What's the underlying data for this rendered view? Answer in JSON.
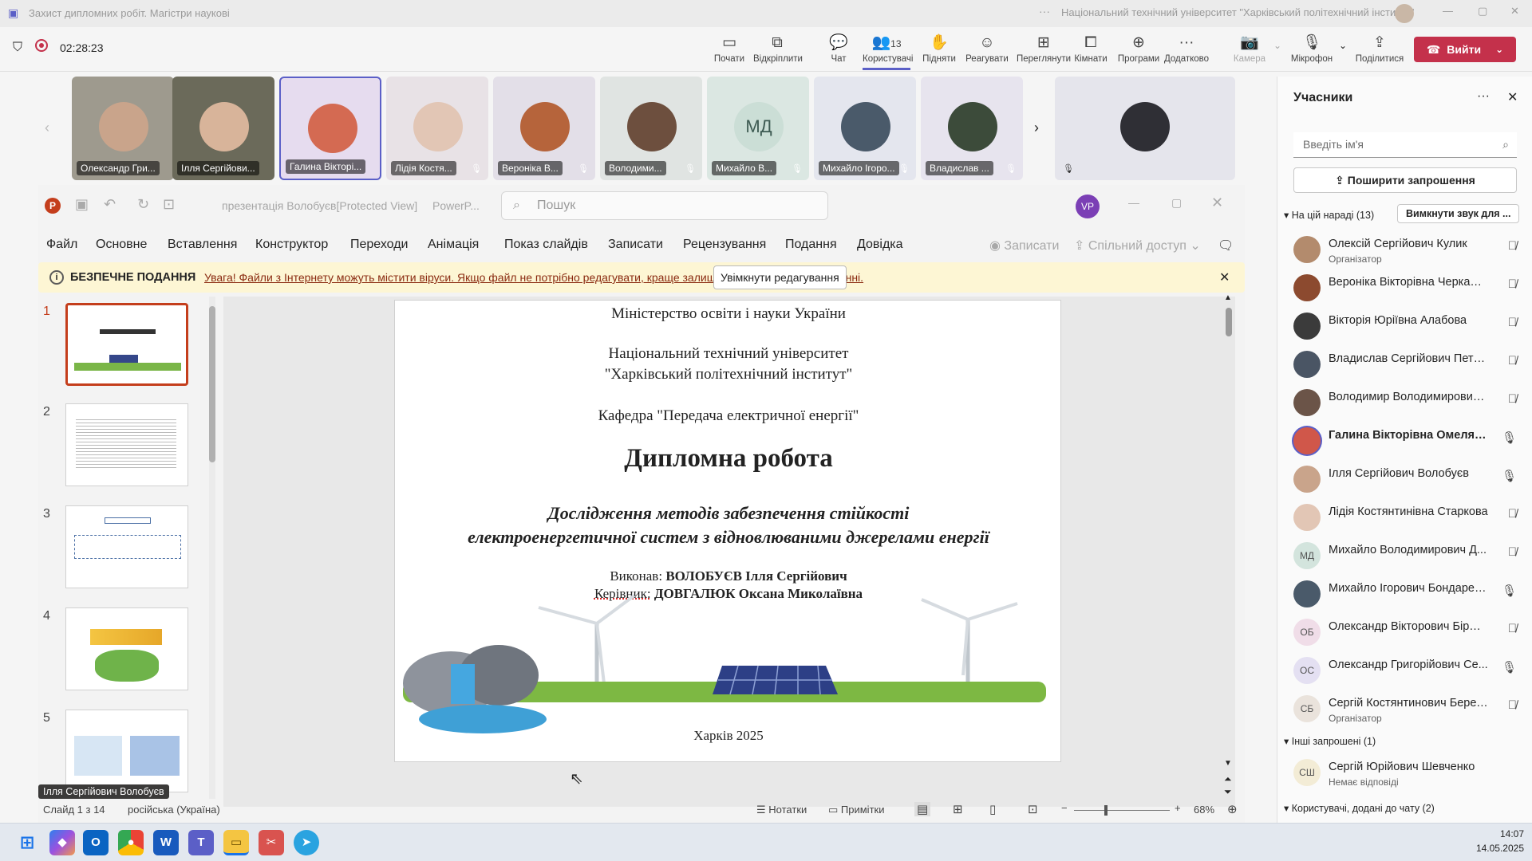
{
  "titlebar": {
    "title": "Захист дипломних робіт. Магістри наукові",
    "org": "Національний технічний університет \"Харківський політехнічний інститут\""
  },
  "call": {
    "timer": "02:28:23",
    "people_count": "13"
  },
  "toolbar": {
    "start": "Почати",
    "open": "Відкріплити",
    "chat": "Чат",
    "people": "Користувачі",
    "raise": "Підняти",
    "react": "Реагувати",
    "view": "Переглянути",
    "rooms": "Кімнати",
    "apps": "Програми",
    "more": "Додатково",
    "camera": "Камера",
    "mic": "Мікрофон",
    "share": "Поділитися",
    "leave": "Вийти"
  },
  "participants_strip": [
    {
      "name": "Олександр Гри..."
    },
    {
      "name": "Ілля Сергійови..."
    },
    {
      "name": "Галина Вікторі..."
    },
    {
      "name": "Лідія Костя..."
    },
    {
      "name": "Вероніка В..."
    },
    {
      "name": "Володими..."
    },
    {
      "name": "Михайло В...",
      "initials": "МД"
    },
    {
      "name": "Михайло Ігоро..."
    },
    {
      "name": "Владислав ..."
    }
  ],
  "ppt": {
    "doc_title": "презентація Волобуєв[Protected View]",
    "app": "PowerP...",
    "search": "Пошук",
    "user": "VP",
    "tabs": [
      "Файл",
      "Основне",
      "Вставлення",
      "Конструктор",
      "Переходи",
      "Анімація",
      "Показ слайдів",
      "Записати",
      "Рецензування",
      "Подання",
      "Довідка"
    ],
    "record": "Записати",
    "coauthor": "Спільний доступ",
    "banner": {
      "label": "БЕЗПЕЧНЕ ПОДАННЯ",
      "text": "Увага! Файли з Інтернету можуть містити віруси. Якщо файл не потрібно редагувати, краще залишатися в безпечному поданні.",
      "button": "Увімкнути редагування"
    },
    "slide_numbers": [
      "1",
      "2",
      "3",
      "4",
      "5"
    ],
    "status": {
      "slide": "Слайд 1 з 14",
      "lang": "російська (Україна)",
      "notes": "Нотатки",
      "comments": "Примітки",
      "zoom": "68%",
      "tooltip": "Ілля Сергійович Волобуєв"
    }
  },
  "slide": {
    "l1": "Міністерство освіти і науки України",
    "l2": "Національний технічний університет",
    "l3": "\"Харківський політехнічний інститут\"",
    "l4": "Кафедра \"Передача електричної енергії\"",
    "title": "Дипломна робота",
    "sub1": "Дослідження методів забезпечення стійкості",
    "sub2": "електроенергетичної систем з відновлюваними джерелами енергії",
    "exec_label": "Виконав:",
    "exec_name": "ВОЛОБУЄВ  Ілля Сергійович",
    "sup_label": "Керівник:",
    "sup_name": "ДОВГАЛЮК Оксана Миколаївна",
    "city": "Харків 2025"
  },
  "panel": {
    "title": "Учасники",
    "search": "Введіть ім'я",
    "invite": "Поширити запрошення",
    "section": "На цій нараді (13)",
    "mute_all": "Вимкнути звук для ...",
    "people": [
      {
        "name": "Олексій Сергійович Кулик",
        "sub": "Організатор",
        "mic": "off"
      },
      {
        "name": "Вероніка Вікторівна Черкаш...",
        "sub": "",
        "mic": "off"
      },
      {
        "name": "Вікторія Юріївна Алабова",
        "sub": "",
        "mic": "off"
      },
      {
        "name": "Владислав Сергійович Петре...",
        "sub": "",
        "mic": "off"
      },
      {
        "name": "Володимир Володимирович ...",
        "sub": "",
        "mic": "off"
      },
      {
        "name": "Галина Вікторівна Омеляне...",
        "sub": "",
        "mic": "on"
      },
      {
        "name": "Ілля Сергійович Волобуєв",
        "sub": "",
        "mic": "on"
      },
      {
        "name": "Лідія Костянтинівна Старкова",
        "sub": "",
        "mic": "off"
      },
      {
        "name": "Михайло Володимирович Д...",
        "sub": "",
        "mic": "off",
        "initials": "МД"
      },
      {
        "name": "Михайло Ігорович Бондарен...",
        "sub": "",
        "mic": "on"
      },
      {
        "name": "Олександр Вікторович Бірюк...",
        "sub": "",
        "mic": "off",
        "initials": "ОБ"
      },
      {
        "name": "Олександр Григорійович Се...",
        "sub": "",
        "mic": "on",
        "initials": "ОС"
      },
      {
        "name": "Сергій Костянтинович Березка",
        "sub": "Організатор",
        "mic": "off",
        "initials": "СБ"
      }
    ],
    "other": "Інші запрошені (1)",
    "other_person": {
      "name": "Сергій Юрійович Шевченко",
      "sub": "Немає відповіді",
      "initials": "СШ"
    },
    "chat_added": "Користувачі, додані до чату (2)"
  },
  "taskbar": {
    "time": "14:07",
    "date": "14.05.2025"
  },
  "colors": {
    "leave": "#c4314b",
    "banner": "#fdf6d4",
    "accent": "#5b5fc7"
  }
}
